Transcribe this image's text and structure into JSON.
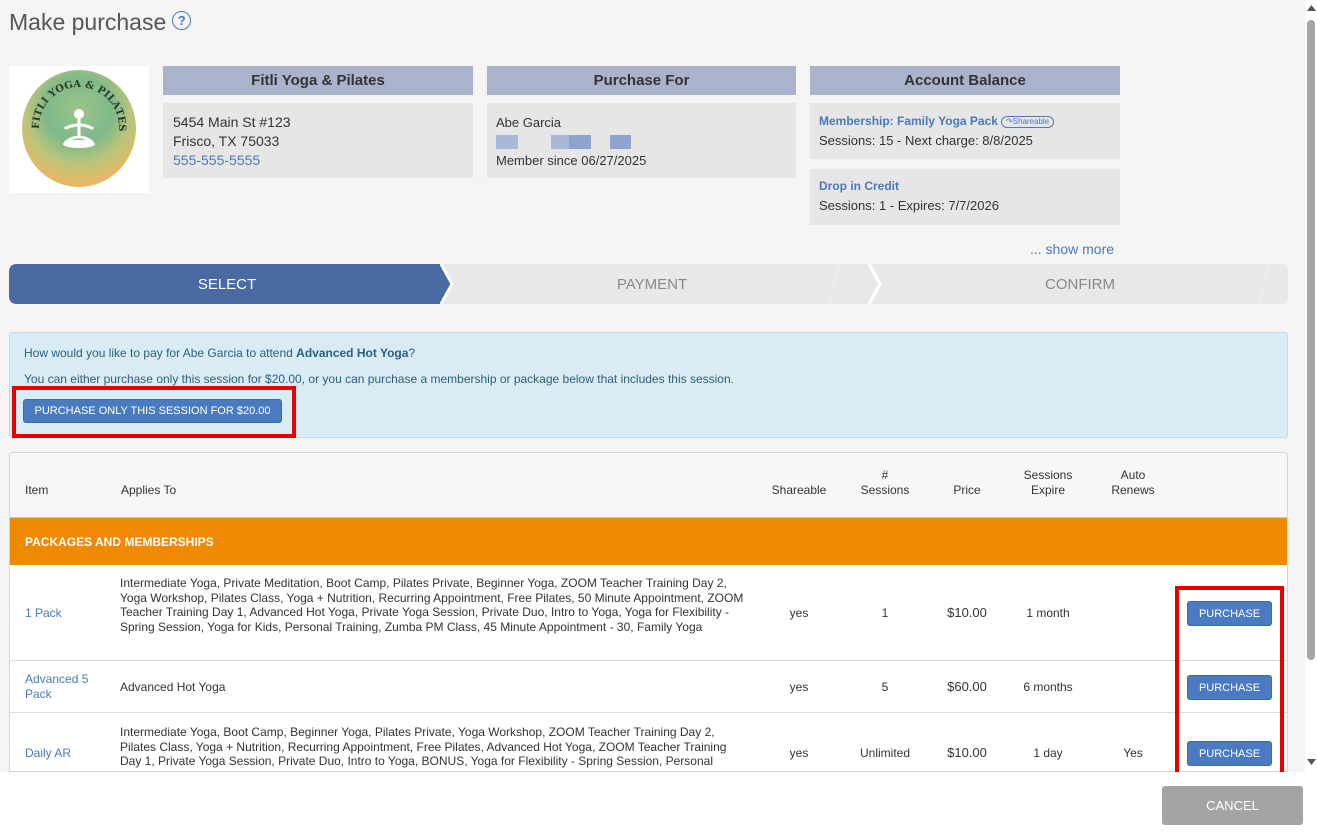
{
  "header": {
    "title": "Make purchase",
    "help_icon": "question-circle-icon"
  },
  "studio": {
    "name": "Fitli Yoga & Pilates",
    "logo_text": "FITLI YOGA & PILATES",
    "address_line1": "5454 Main St #123",
    "address_line2": "Frisco, TX 75033",
    "phone": "555-555-5555"
  },
  "purchase_for": {
    "heading": "Purchase For",
    "name": "Abe Garcia",
    "member_since": "Member since 06/27/2025"
  },
  "account_balance": {
    "heading": "Account Balance",
    "items": [
      {
        "title": "Membership: Family Yoga Pack",
        "badge": "Shareable",
        "detail": "Sessions: 15 -  Next charge: 8/8/2025"
      },
      {
        "title": "Drop in Credit",
        "detail": "Sessions: 1 -  Expires: 7/7/2026"
      }
    ],
    "show_more": "... show more"
  },
  "steps": [
    {
      "label": "SELECT",
      "active": true
    },
    {
      "label": "PAYMENT",
      "active": false
    },
    {
      "label": "CONFIRM",
      "active": false
    }
  ],
  "info": {
    "question_prefix": "How would you like to pay for Abe Garcia to attend ",
    "class_name": "Advanced Hot Yoga",
    "question_suffix": "?",
    "explanation": "You can either purchase only this session for $20.00, or you can purchase a membership or package below that includes this session.",
    "button_label": "PURCHASE ONLY THIS SESSION FOR $20.00"
  },
  "table": {
    "columns": {
      "item": "Item",
      "applies_to": "Applies To",
      "shareable": "Shareable",
      "sessions_1": "#",
      "sessions_2": "Sessions",
      "price": "Price",
      "expire_1": "Sessions",
      "expire_2": "Expire",
      "renew_1": "Auto",
      "renew_2": "Renews"
    },
    "section_title": "PACKAGES AND MEMBERSHIPS",
    "rows": [
      {
        "item": "1 Pack",
        "applies_to": "Intermediate Yoga, Private Meditation, Boot Camp, Pilates Private, Beginner Yoga, ZOOM Teacher Training Day 2, Yoga Workshop, Pilates Class, Yoga + Nutrition, Recurring Appointment, Free Pilates, 50 Minute Appointment, ZOOM Teacher Training Day 1, Advanced Hot Yoga, Private Yoga Session, Private Duo, Intro to Yoga, Yoga for Flexibility - Spring Session, Yoga for Kids, Personal Training, Zumba PM Class, 45 Minute Appointment - 30, Family Yoga",
        "shareable": "yes",
        "sessions": "1",
        "price": "$10.00",
        "expire": "1 month",
        "auto_renews": "",
        "button": "PURCHASE"
      },
      {
        "item": "Advanced 5 Pack",
        "applies_to": "Advanced Hot Yoga",
        "shareable": "yes",
        "sessions": "5",
        "price": "$60.00",
        "expire": "6 months",
        "auto_renews": "",
        "button": "PURCHASE"
      },
      {
        "item": "Daily AR",
        "applies_to": "Intermediate Yoga, Boot Camp, Beginner Yoga, Pilates Private, Yoga Workshop, ZOOM Teacher Training Day 2, Pilates Class, Yoga + Nutrition, Recurring Appointment, Free Pilates, Advanced Hot Yoga, ZOOM Teacher Training Day 1, Private Yoga Session, Private Duo, Intro to Yoga, BONUS, Yoga for Flexibility - Spring Session, Personal",
        "shareable": "yes",
        "sessions": "Unlimited",
        "price": "$10.00",
        "expire": "1 day",
        "auto_renews": "Yes",
        "button": "PURCHASE"
      }
    ]
  },
  "footer": {
    "cancel_label": "CANCEL"
  },
  "colors": {
    "accent": "#4a6fa5",
    "section": "#ef8a00",
    "highlight": "#e60000"
  }
}
